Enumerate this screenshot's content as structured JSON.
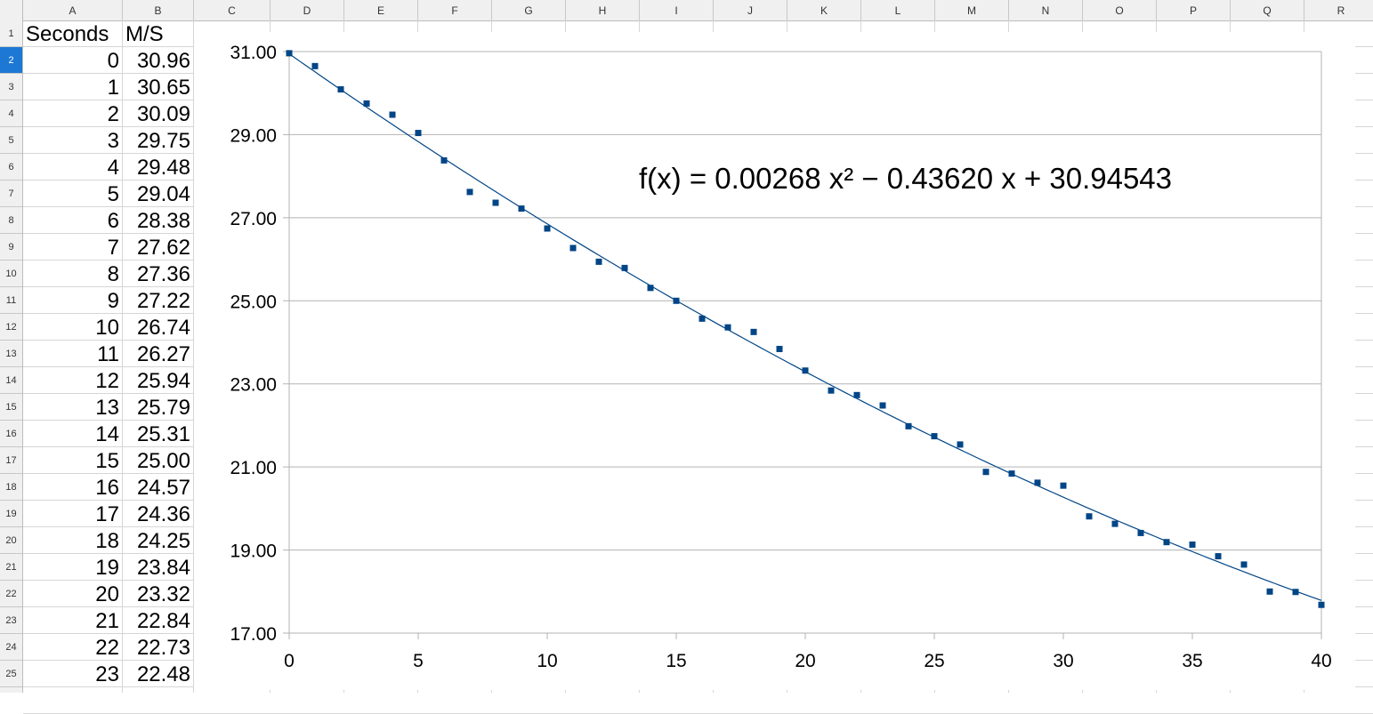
{
  "columns": [
    "A",
    "B",
    "C",
    "D",
    "E",
    "F",
    "G",
    "H",
    "I",
    "J",
    "K",
    "L",
    "M",
    "N",
    "O",
    "P",
    "Q",
    "R"
  ],
  "rows": [
    "1",
    "2",
    "3",
    "4",
    "5",
    "6",
    "7",
    "8",
    "9",
    "10",
    "11",
    "12",
    "13",
    "14",
    "15",
    "16",
    "17",
    "18",
    "19",
    "20",
    "21",
    "22",
    "23",
    "24",
    "25"
  ],
  "selected_row": "2",
  "sheet": {
    "headers": [
      "Seconds",
      "M/S"
    ],
    "seconds": [
      "0",
      "1",
      "2",
      "3",
      "4",
      "5",
      "6",
      "7",
      "8",
      "9",
      "10",
      "11",
      "12",
      "13",
      "14",
      "15",
      "16",
      "17",
      "18",
      "19",
      "20",
      "21",
      "22",
      "23"
    ],
    "ms": [
      "30.96",
      "30.65",
      "30.09",
      "29.75",
      "29.48",
      "29.04",
      "28.38",
      "27.62",
      "27.36",
      "27.22",
      "26.74",
      "26.27",
      "25.94",
      "25.79",
      "25.31",
      "25.00",
      "24.57",
      "24.36",
      "24.25",
      "23.84",
      "23.32",
      "22.84",
      "22.73",
      "22.48"
    ]
  },
  "chart_data": {
    "type": "scatter",
    "title": "",
    "xlabel": "",
    "ylabel": "",
    "xlim": [
      0,
      40
    ],
    "ylim": [
      17,
      31
    ],
    "xticks": [
      "0",
      "5",
      "10",
      "15",
      "20",
      "25",
      "30",
      "35",
      "40"
    ],
    "yticks": [
      "31.00",
      "29.00",
      "27.00",
      "25.00",
      "23.00",
      "21.00",
      "19.00",
      "17.00"
    ],
    "grid": "horizontal",
    "legend": "none",
    "marker_color": "#004586",
    "trend_color": "#004586",
    "x": [
      0,
      1,
      2,
      3,
      4,
      5,
      6,
      7,
      8,
      9,
      10,
      11,
      12,
      13,
      14,
      15,
      16,
      17,
      18,
      19,
      20,
      21,
      22,
      23,
      24,
      25,
      26,
      27,
      28,
      29,
      30,
      31,
      32,
      33,
      34,
      35,
      36,
      37,
      38,
      39,
      40
    ],
    "y": [
      30.96,
      30.65,
      30.09,
      29.75,
      29.48,
      29.04,
      28.38,
      27.62,
      27.36,
      27.22,
      26.74,
      26.27,
      25.94,
      25.79,
      25.31,
      25.0,
      24.57,
      24.36,
      24.25,
      23.84,
      23.32,
      22.84,
      22.73,
      22.48,
      21.98,
      21.74,
      21.54,
      20.88,
      20.84,
      20.62,
      20.55,
      19.81,
      19.63,
      19.41,
      19.19,
      19.13,
      18.85,
      18.65,
      18.0,
      17.99,
      17.68
    ],
    "trendline": {
      "type": "polynomial",
      "coefficients": [
        0.00268,
        -0.4362,
        30.94543
      ],
      "equation": "f(x) = 0.00268 x² − 0.43620 x + 30.94543"
    }
  }
}
